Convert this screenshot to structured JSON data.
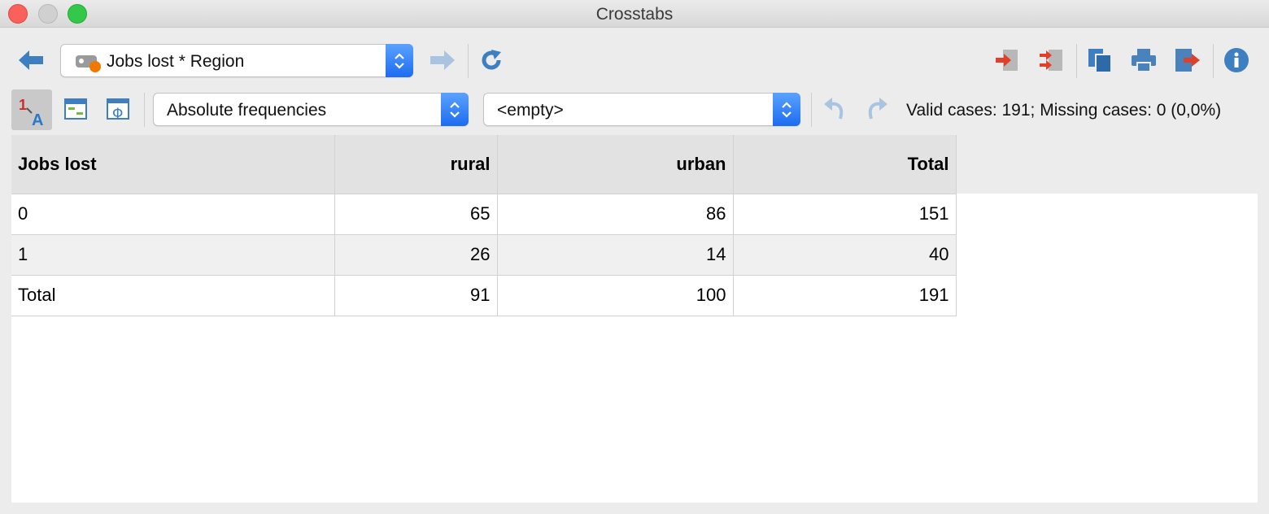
{
  "window": {
    "title": "Crosstabs"
  },
  "toolbar": {
    "table_selector": {
      "value": "Jobs lost * Region",
      "icon": "variable-tag-icon"
    },
    "display_mode": {
      "value": "Absolute frequencies"
    },
    "secondary_mode": {
      "value": "<empty>"
    }
  },
  "status": {
    "text": "Valid cases: 191;  Missing cases: 0 (0,0%)"
  },
  "table": {
    "row_variable": "Jobs lost",
    "columns": [
      "rural",
      "urban",
      "Total"
    ],
    "rows": [
      {
        "label": "0",
        "values": [
          "65",
          "86",
          "151"
        ]
      },
      {
        "label": "1",
        "values": [
          "26",
          "14",
          "40"
        ]
      },
      {
        "label": "Total",
        "values": [
          "91",
          "100",
          "191"
        ]
      }
    ]
  },
  "colors": {
    "accent_blue": "#2a78c8",
    "stepper_blue": "#1d6cf0",
    "export_red": "#e0402a",
    "tag_orange": "#f07800"
  }
}
